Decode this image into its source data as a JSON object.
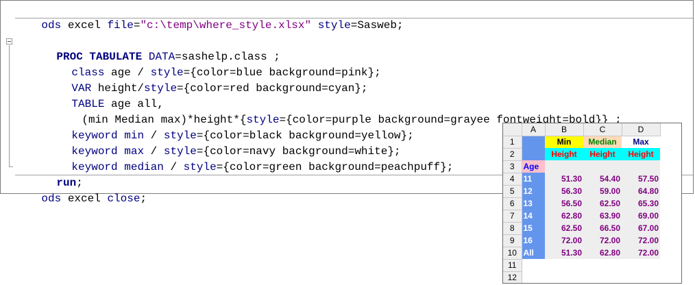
{
  "code": {
    "line1": [
      "ods",
      " excel ",
      "file",
      "=",
      "\"c:\\temp\\where_style.xlsx\"",
      " ",
      "style",
      "=Sasweb;"
    ],
    "line3": [
      "PROC TABULATE",
      " ",
      "DATA",
      "=sashelp.class ;"
    ],
    "line4": [
      "class",
      " age / ",
      "style",
      "={color=blue background=pink};"
    ],
    "line5": [
      "VAR",
      " height/",
      "style",
      "={color=red background=cyan};"
    ],
    "line6": [
      "TABLE",
      " age all,"
    ],
    "line7": [
      "(min Median max)*height*{",
      "style",
      "={color=purple background=grayee fontweight=bold}} ;"
    ],
    "line8": [
      "keyword",
      " ",
      "min",
      " / ",
      "style",
      "={color=black background=yellow};"
    ],
    "line9": [
      "keyword",
      " ",
      "max",
      " / ",
      "style",
      "={color=navy background=white};"
    ],
    "line10": [
      "keyword",
      " ",
      "median",
      " / ",
      "style",
      "={color=green background=peachpuff};"
    ],
    "line11": [
      "run",
      ";"
    ],
    "line12": [
      "ods",
      " excel ",
      "close",
      ";"
    ]
  },
  "sheet": {
    "col_headers": [
      "A",
      "B",
      "C",
      "D"
    ],
    "row_numbers": [
      "1",
      "2",
      "3",
      "4",
      "5",
      "6",
      "7",
      "8",
      "9",
      "10",
      "11",
      "12"
    ],
    "stat_headers": [
      "Min",
      "Median",
      "Max"
    ],
    "var_headers": [
      "Height",
      "Height",
      "Height"
    ],
    "class_label": "Age",
    "rows": [
      {
        "label": "11",
        "min": "51.30",
        "median": "54.40",
        "max": "57.50"
      },
      {
        "label": "12",
        "min": "56.30",
        "median": "59.00",
        "max": "64.80"
      },
      {
        "label": "13",
        "min": "56.50",
        "median": "62.50",
        "max": "65.30"
      },
      {
        "label": "14",
        "min": "62.80",
        "median": "63.90",
        "max": "69.00"
      },
      {
        "label": "15",
        "min": "62.50",
        "median": "66.50",
        "max": "67.00"
      },
      {
        "label": "16",
        "min": "72.00",
        "median": "72.00",
        "max": "72.00"
      },
      {
        "label": "All",
        "min": "51.30",
        "median": "62.80",
        "max": "72.00"
      }
    ]
  },
  "colors": {
    "keyword": "#000080",
    "string": "#800080",
    "class_bg": "#6495ed",
    "values": "#800080",
    "min_bg": "#ffff00",
    "median_bg": "#ffdab9",
    "median_fg": "#008000",
    "max_fg": "#000080",
    "height_bg": "#00ffff",
    "height_fg": "#ff0000",
    "age_bg": "#ffc0cb",
    "age_fg": "#0000ff"
  }
}
